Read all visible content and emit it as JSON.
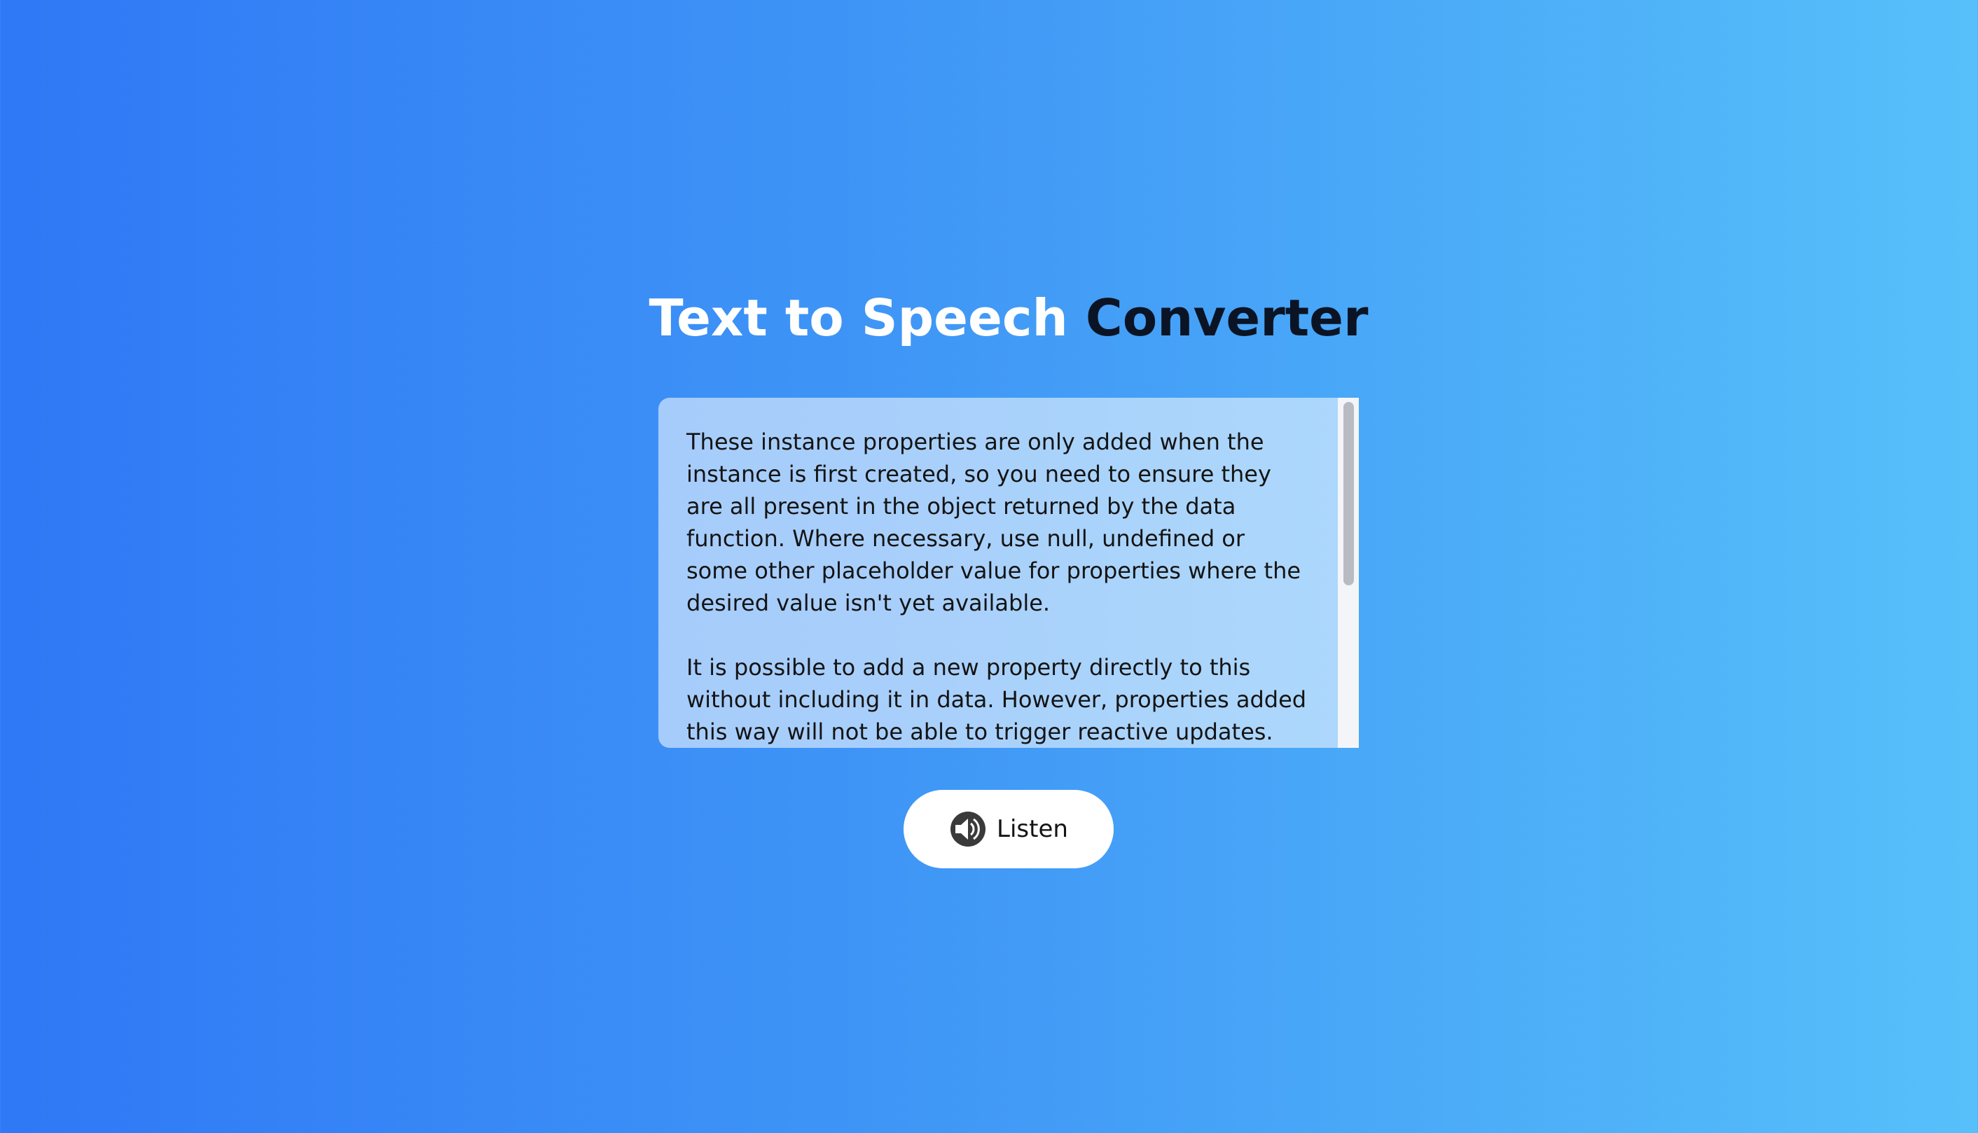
{
  "title": {
    "part1": "Text to Speech",
    "part2": "Converter"
  },
  "textarea": {
    "paragraphs": [
      "These instance properties are only added when the instance is first created, so you need to ensure they are all present in the object returned by the data function. Where necessary, use null, undefined or some other placeholder value for properties where the desired value isn't yet available.",
      "It is possible to add a new property directly to this without including it in data. However, properties added this way will not be able to trigger reactive updates."
    ]
  },
  "listen_button": {
    "label": "Listen",
    "icon": "speaker-icon"
  },
  "colors": {
    "gradient_start": "#2f78f6",
    "gradient_end": "#57c0fa",
    "title_light": "#ffffff",
    "title_dark": "#0b1424"
  }
}
